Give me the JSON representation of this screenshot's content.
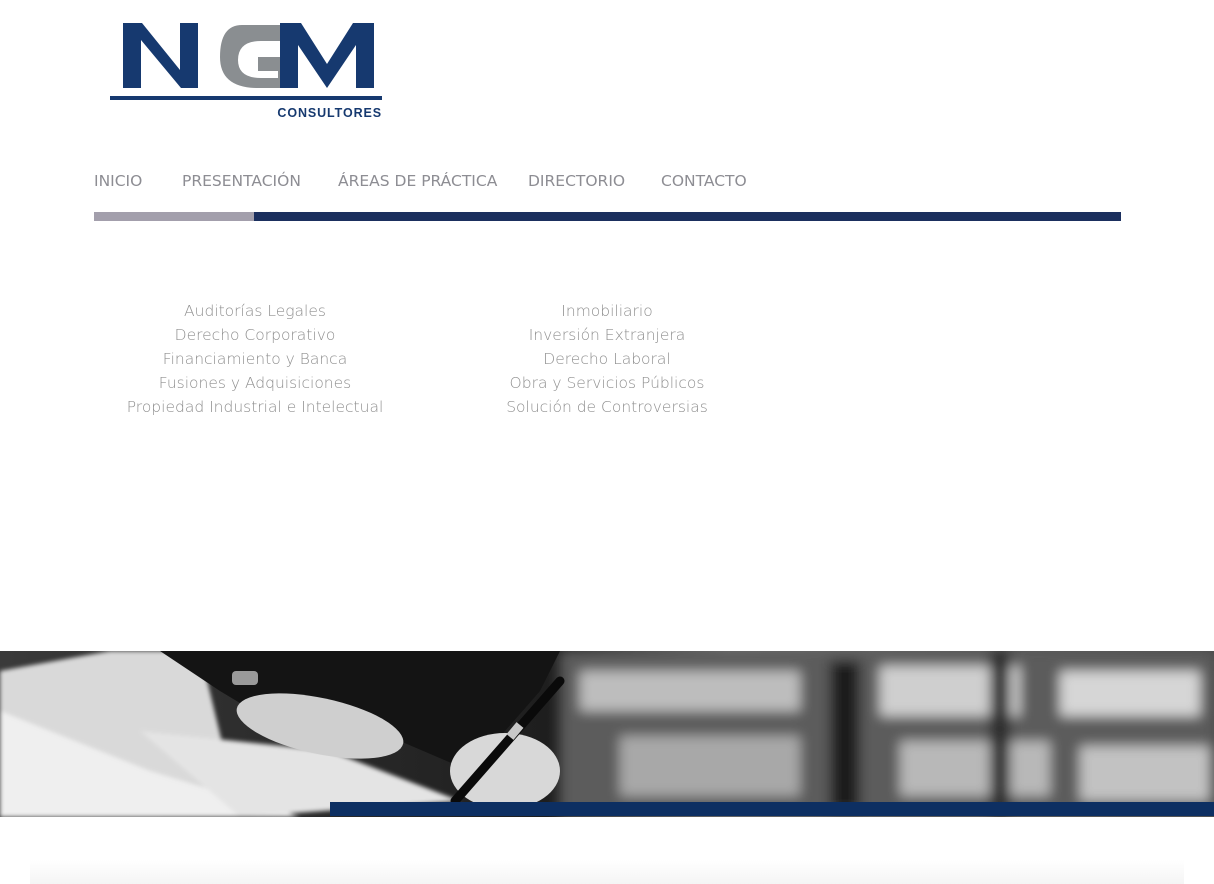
{
  "brand": {
    "logo_letters": "NGM",
    "logo_subtitle": "CONSULTORES",
    "colors": {
      "navy": "#16396f",
      "grey": "#8a8e91"
    }
  },
  "nav": {
    "items": [
      {
        "label": "INICIO"
      },
      {
        "label": "PRESENTACIÓN"
      },
      {
        "label": "ÁREAS DE PRÁCTICA"
      },
      {
        "label": "DIRECTORIO"
      },
      {
        "label": "CONTACTO"
      }
    ],
    "colors": {
      "active_bar": "#a39fac",
      "bar": "#1b2f5e",
      "text": "#8d8d93"
    }
  },
  "practice_areas": {
    "left": [
      "Auditorías Legales",
      "Derecho Corporativo",
      "Financiamiento y Banca",
      "Fusiones y Adquisiciones",
      "Propiedad Industrial e Intelectual"
    ],
    "right": [
      "Inmobiliario",
      "Inversión Extranjera",
      "Derecho Laboral",
      "Obra y Servicios Públicos",
      "Solución de Controversias"
    ]
  },
  "banner": {
    "image": "black-and-white photo of a hand signing a document with a fountain pen",
    "stripe_color": "#0d2f62"
  }
}
